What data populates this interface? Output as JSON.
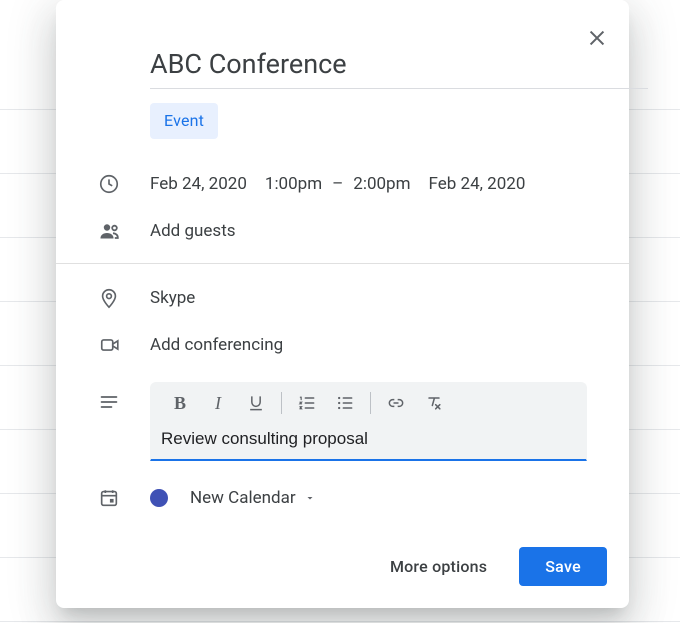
{
  "title": "ABC Conference",
  "chip": {
    "event_label": "Event"
  },
  "time": {
    "start_date": "Feb 24, 2020",
    "start_time": "1:00pm",
    "end_time": "2:00pm",
    "end_date": "Feb 24, 2020",
    "dash": "–"
  },
  "guests_placeholder": "Add guests",
  "location": "Skype",
  "conferencing_placeholder": "Add conferencing",
  "description": "Review consulting proposal",
  "toolbar": {
    "bold": "B",
    "italic": "I"
  },
  "calendar": {
    "name": "New Calendar",
    "color": "#3f51b5"
  },
  "footer": {
    "more_options": "More options",
    "save": "Save"
  }
}
